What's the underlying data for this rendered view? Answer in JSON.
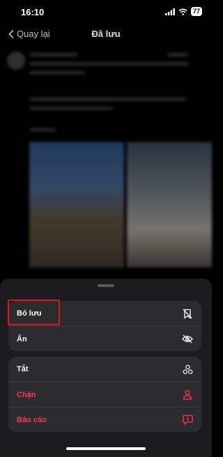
{
  "status_bar": {
    "time": "16:10",
    "battery": "77"
  },
  "nav": {
    "back_label": "Quay lại",
    "title": "Đã lưu"
  },
  "sheet": {
    "group1": [
      {
        "label": "Bỏ lưu",
        "icon": "unsave-bookmark-icon"
      },
      {
        "label": "Ẩn",
        "icon": "eye-slash-icon"
      }
    ],
    "group2": [
      {
        "label": "Tắt",
        "icon": "mute-icon"
      },
      {
        "label": "Chặn",
        "icon": "block-user-icon",
        "color": "#ff375f"
      },
      {
        "label": "Báo cáo",
        "icon": "report-icon",
        "color": "#ff375f"
      }
    ]
  },
  "colors": {
    "sheet_bg": "#1c1c1e",
    "row_bg": "#2c2c2e",
    "danger": "#ff375f",
    "highlight": "#e0141e"
  }
}
